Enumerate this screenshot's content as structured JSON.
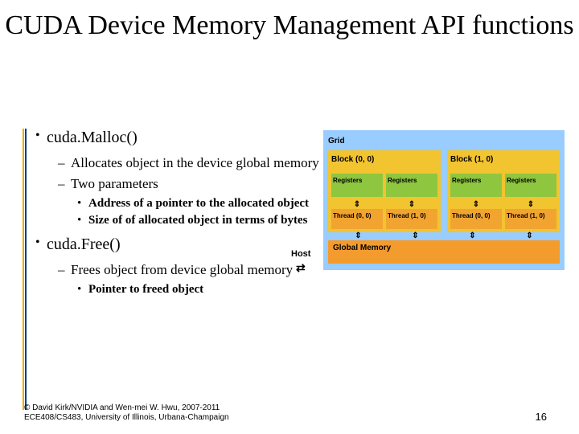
{
  "title": "CUDA Device Memory Management API functions",
  "bullets": {
    "b1": "cuda.Malloc()",
    "b1s1": "Allocates object in the device global memory",
    "b1s2": "Two parameters",
    "b1s2a": "Address of a pointer to the allocated object",
    "b1s2b": "Size of of allocated object in terms of bytes",
    "b2": "cuda.Free()",
    "b2s1": "Frees object from device global memory",
    "b2s1a": "Pointer to freed object"
  },
  "diagram": {
    "grid": "Grid",
    "block00": "Block (0, 0)",
    "block10": "Block (1, 0)",
    "registers": "Registers",
    "thread00": "Thread (0, 0)",
    "thread10": "Thread (1, 0)",
    "globmem": "Global Memory",
    "host": "Host"
  },
  "footer": {
    "l1": "© David Kirk/NVIDIA and Wen-mei W. Hwu, 2007-2011",
    "l2": "ECE408/CS483, University of Illinois, Urbana-Champaign"
  },
  "pagenum": "16"
}
